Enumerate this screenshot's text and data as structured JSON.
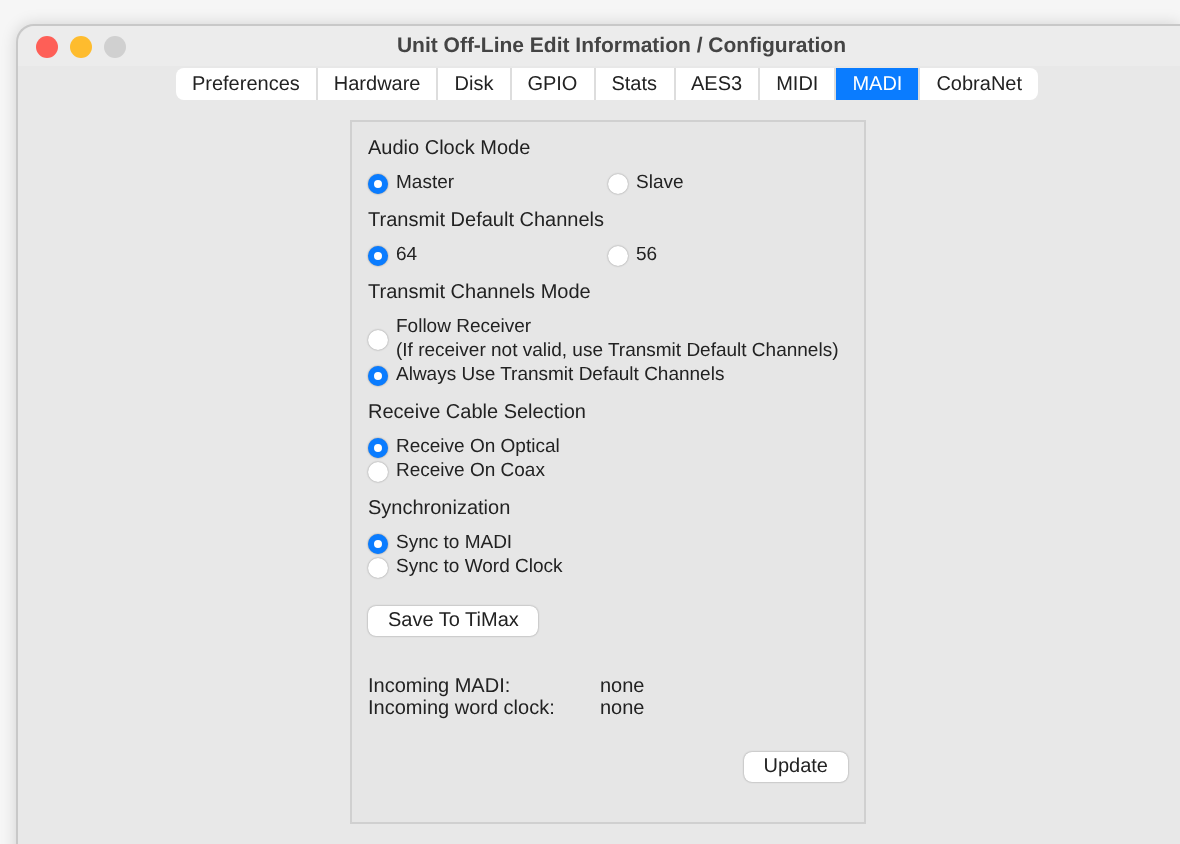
{
  "window": {
    "title": "Unit Off-Line Edit Information / Configuration"
  },
  "tabs": [
    {
      "label": "Preferences",
      "selected": false
    },
    {
      "label": "Hardware",
      "selected": false
    },
    {
      "label": "Disk",
      "selected": false
    },
    {
      "label": "GPIO",
      "selected": false
    },
    {
      "label": "Stats",
      "selected": false
    },
    {
      "label": "AES3",
      "selected": false
    },
    {
      "label": "MIDI",
      "selected": false
    },
    {
      "label": "MADI",
      "selected": true
    },
    {
      "label": "CobraNet",
      "selected": false
    }
  ],
  "groups": [
    {
      "title": "Audio Clock Mode",
      "kind": "row",
      "options": [
        {
          "label": "Master",
          "selected": true
        },
        {
          "label": "Slave",
          "selected": false
        }
      ]
    },
    {
      "title": "Transmit Default Channels",
      "kind": "row",
      "options": [
        {
          "label": "64",
          "selected": true
        },
        {
          "label": "56",
          "selected": false
        }
      ]
    },
    {
      "title": "Transmit Channels Mode",
      "kind": "column",
      "options": [
        {
          "label": "Follow Receiver",
          "note": "(If receiver not valid, use Transmit Default Channels)",
          "selected": false
        },
        {
          "label": "Always Use Transmit Default Channels",
          "selected": true
        }
      ]
    },
    {
      "title": "Receive Cable Selection",
      "kind": "column",
      "options": [
        {
          "label": "Receive On Optical",
          "selected": true
        },
        {
          "label": "Receive On Coax",
          "selected": false
        }
      ]
    },
    {
      "title": "Synchronization",
      "kind": "column",
      "options": [
        {
          "label": "Sync to MADI",
          "selected": true
        },
        {
          "label": "Sync to Word Clock",
          "selected": false
        }
      ]
    }
  ],
  "save_button": "Save To TiMax",
  "status": [
    {
      "label": "Incoming MADI:",
      "value": "none"
    },
    {
      "label": "Incoming word clock:",
      "value": "none"
    }
  ],
  "update_button": "Update"
}
